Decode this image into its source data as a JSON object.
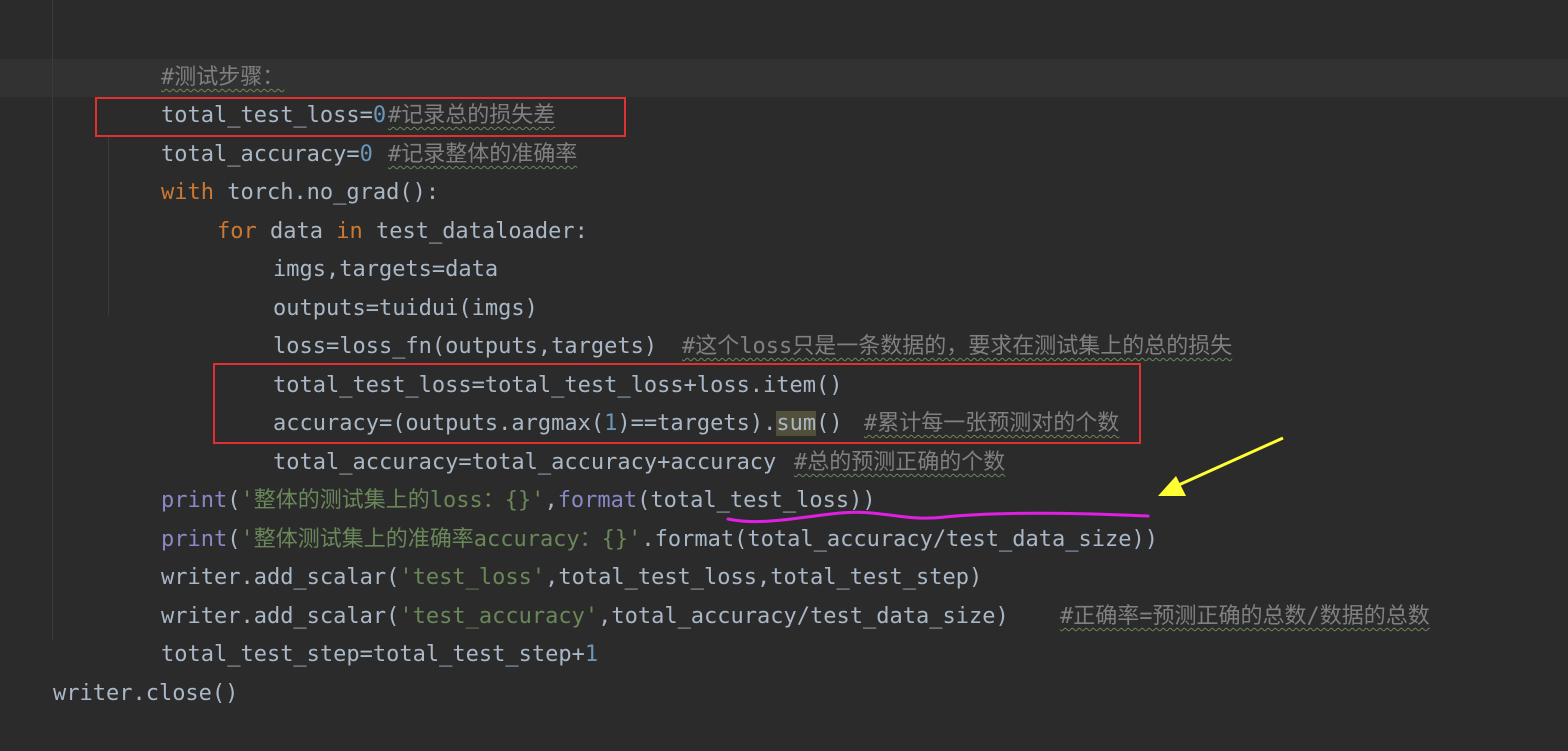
{
  "code": {
    "l01": {
      "cmt": "#测试步骤："
    },
    "l02": {
      "a": "total_test_loss=",
      "n": "0",
      "cmt": "#记录总的损失差"
    },
    "l03": {
      "a": "total_accuracy=",
      "n": "0",
      "cmt": "#记录整体的准确率"
    },
    "l04": {
      "kw": "with",
      "a": " torch.no_grad():"
    },
    "l05": {
      "kw1": "for",
      "a": " data ",
      "kw2": "in",
      "b": " test_dataloader:"
    },
    "l06": {
      "a": "imgs,targets=data"
    },
    "l07": {
      "a": "outputs=tuidui(imgs)"
    },
    "l08": {
      "a": "loss=loss_fn(outputs,targets)",
      "cmt": "#这个loss只是一条数据的，要求在测试集上的总的损失"
    },
    "l09": {
      "a": "total_test_loss=total_test_loss+loss.item()"
    },
    "l10": {
      "a": "accuracy=(outputs.argmax(",
      "n": "1",
      "b": ")==targets).",
      "hl": "sum",
      "c": "()",
      "cmt": "#累计每一张预测对的个数"
    },
    "l11": {
      "a": "total_accuracy=total_accuracy+accuracy",
      "cmt": "#总的预测正确的个数"
    },
    "l12": {
      "fn1": "print",
      "a": "(",
      "str": "'整体的测试集上的loss：{}'",
      "b": ",",
      "fn2": "format",
      "c": "(total_test_loss))"
    },
    "l13": {
      "fn": "print",
      "a": "(",
      "str": "'整体测试集上的准确率accuracy：{}'",
      "b": ".format(total_accuracy/test_data_size))"
    },
    "l14": {
      "a": "writer.add_scalar(",
      "str": "'test_loss'",
      "b": ",total_test_loss,total_test_step)"
    },
    "l15": {
      "a": "writer.add_scalar(",
      "str": "'test_accuracy'",
      "b": ",total_accuracy/test_data_size)",
      "cmt": "#正确率=预测正确的总数/数据的总数"
    },
    "l16": {
      "a": "total_test_step=total_test_step+",
      "n": "1"
    },
    "l17": {
      "a": "writer.close()"
    }
  },
  "colors": {
    "background": "#2b2b2b",
    "keyword": "#cc7832",
    "number": "#6897bb",
    "string": "#6a8759",
    "comment": "#808080",
    "builtin": "#8888c6",
    "annotation_box": "#e03131",
    "arrow": "#ffff33",
    "underline": "#e020e0"
  }
}
